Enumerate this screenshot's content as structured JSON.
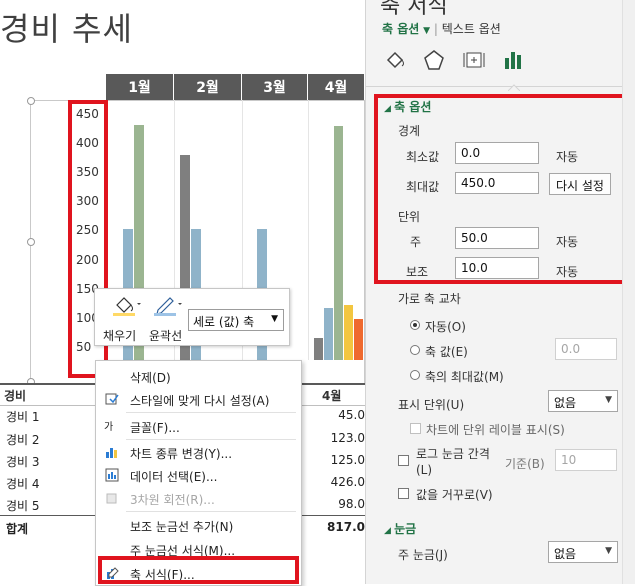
{
  "title": "경비 추세",
  "months": [
    "1월",
    "2월",
    "3월",
    "4월"
  ],
  "chart_data": {
    "type": "bar",
    "yticks": [
      "450",
      "400",
      "350",
      "300",
      "250",
      "200",
      "150",
      "100",
      "50"
    ],
    "ylim": [
      0,
      450
    ],
    "categories": [
      "1월",
      "2월",
      "3월",
      "4월"
    ],
    "series": [
      {
        "name": "경비 1",
        "color": "#7f7f7f",
        "values": [
          0,
          375,
          0,
          40
        ]
      },
      {
        "name": "경비 2",
        "color": "#8fb3c9",
        "values": [
          240,
          240,
          240,
          95
        ]
      },
      {
        "name": "경비 3",
        "color": "#9bb591",
        "values": [
          430,
          0,
          0,
          428
        ]
      },
      {
        "name": "경비 4",
        "color": "#f3c640",
        "values": [
          0,
          0,
          0,
          100
        ]
      },
      {
        "name": "경비 5",
        "color": "#ef6a2f",
        "values": [
          0,
          0,
          0,
          75
        ]
      }
    ]
  },
  "table": {
    "header_left": "경비",
    "header_right": "4월",
    "rows": [
      {
        "label": "경비 1",
        "value": "45.0"
      },
      {
        "label": "경비 2",
        "value": "123.0"
      },
      {
        "label": "경비 3",
        "value": "125.0"
      },
      {
        "label": "경비 4",
        "value": "426.0"
      },
      {
        "label": "경비 5",
        "value": "98.0"
      },
      {
        "label": "합계",
        "value": "817.0"
      }
    ]
  },
  "mini_toolbar": {
    "fill_label": "채우기",
    "outline_label": "윤곽선",
    "selection": "세로 (값) 축"
  },
  "context_menu": [
    {
      "label": "삭제(D)",
      "disabled": false
    },
    {
      "label": "스타일에 맞게 다시 설정(A)",
      "disabled": false
    },
    {
      "label": "글꼴(F)...",
      "disabled": false
    },
    {
      "label": "차트 종류 변경(Y)...",
      "disabled": false
    },
    {
      "label": "데이터 선택(E)...",
      "disabled": false
    },
    {
      "label": "3차원 회전(R)...",
      "disabled": true
    },
    {
      "label": "보조 눈금선 추가(N)",
      "disabled": false
    },
    {
      "label": "주 눈금선 서식(M)...",
      "disabled": false
    },
    {
      "label": "축 서식(F)...",
      "disabled": false
    }
  ],
  "pane": {
    "title": "축 서식",
    "tab_axis": "축 옵션",
    "tab_text": "텍스트 옵션",
    "section_axis_options": "축 옵션",
    "bounds_label": "경계",
    "min_label": "최소값",
    "min_value": "0.0",
    "min_auto": "자동",
    "max_label": "최대값",
    "max_value": "450.0",
    "reset_button": "다시 설정",
    "units_label": "단위",
    "major_label": "주",
    "major_value": "50.0",
    "major_auto": "자동",
    "minor_label": "보조",
    "minor_value": "10.0",
    "minor_auto": "자동",
    "cross_label": "가로 축 교차",
    "radio_auto": "자동(O)",
    "radio_value": "축 값(E)",
    "radio_value_input": "0.0",
    "radio_max": "축의 최대값(M)",
    "display_units_label": "표시 단위(U)",
    "display_units_value": "없음",
    "show_units_label": "차트에 단위 레이블 표시(S)",
    "log_scale_label": "로그 눈금 간격(L)",
    "base_label": "기준(B)",
    "base_value": "10",
    "reverse_label": "값을 거꾸로(V)",
    "section_ticks": "눈금",
    "major_tick_label": "주 눈금(J)",
    "major_tick_value": "없음"
  }
}
